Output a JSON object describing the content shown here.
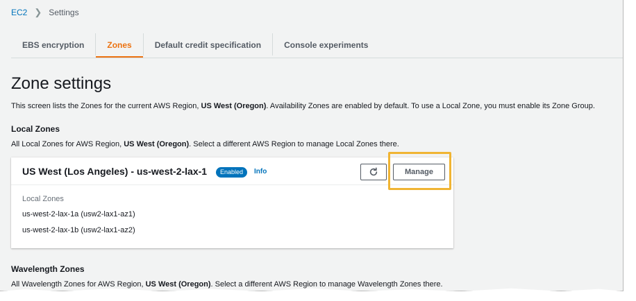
{
  "breadcrumb": {
    "root": "EC2",
    "current": "Settings"
  },
  "tabs": [
    {
      "label": "EBS encryption",
      "active": false
    },
    {
      "label": "Zones",
      "active": true
    },
    {
      "label": "Default credit specification",
      "active": false
    },
    {
      "label": "Console experiments",
      "active": false
    }
  ],
  "page": {
    "title": "Zone settings",
    "intro_prefix": "This screen lists the Zones for the current AWS Region, ",
    "region": "US West (Oregon)",
    "intro_suffix": ". Availability Zones are enabled by default. To use a Local Zone, you must enable its Zone Group."
  },
  "local_zones": {
    "heading": "Local Zones",
    "desc_prefix": "All Local Zones for AWS Region, ",
    "region": "US West (Oregon)",
    "desc_suffix": ". Select a different AWS Region to manage Local Zones there.",
    "card": {
      "title": "US West (Los Angeles) - us-west-2-lax-1",
      "status_badge": "Enabled",
      "info_link": "Info",
      "refresh_icon": "refresh-icon",
      "manage_label": "Manage",
      "body_label": "Local Zones",
      "zones": [
        "us-west-2-lax-1a (usw2-lax1-az1)",
        "us-west-2-lax-1b (usw2-lax1-az2)"
      ]
    }
  },
  "wavelength_zones": {
    "heading": "Wavelength Zones",
    "desc_prefix": "All Wavelength Zones for AWS Region, ",
    "region": "US West (Oregon)",
    "desc_suffix": ". Select a different AWS Region to manage Wavelength Zones there."
  },
  "colors": {
    "accent_orange": "#ec7211",
    "link_blue": "#0073bb",
    "highlight": "#f0b433",
    "background": "#f2f3f3"
  }
}
